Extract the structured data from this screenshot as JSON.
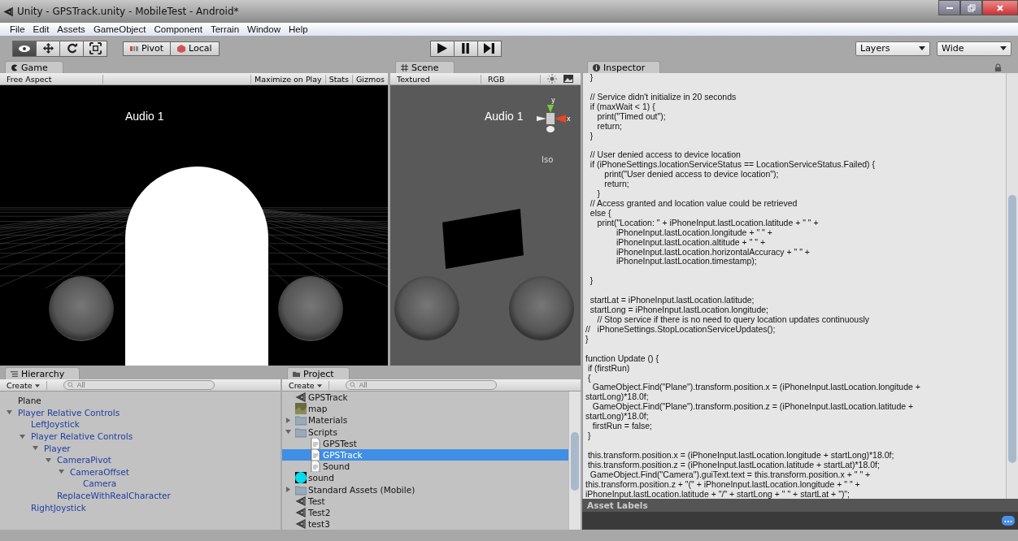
{
  "window": {
    "title": "Unity - GPSTrack.unity - MobileTest - Android*"
  },
  "menu": [
    "File",
    "Edit",
    "Assets",
    "GameObject",
    "Component",
    "Terrain",
    "Window",
    "Help"
  ],
  "toolbar": {
    "tools": [
      {
        "kind": "view",
        "selected": true
      },
      {
        "kind": "move",
        "selected": false
      },
      {
        "kind": "rotate",
        "selected": false
      },
      {
        "kind": "scale",
        "selected": false
      }
    ],
    "pivot": "Pivot",
    "local": "Local",
    "playback": [
      {
        "kind": "play"
      },
      {
        "kind": "pause"
      },
      {
        "kind": "step"
      }
    ],
    "layers": "Layers",
    "layout": "Wide"
  },
  "game": {
    "tab": "Game",
    "aspect": "Free Aspect",
    "buttons": [
      "Maximize on Play",
      "Stats",
      "Gizmos"
    ],
    "overlay_text": "Audio 1"
  },
  "scene": {
    "tab": "Scene",
    "render_mode": "Textured",
    "channel": "RGB",
    "overlay_text": "Audio 1",
    "gizmo_axes": [
      "y",
      "x"
    ],
    "projection": "Iso"
  },
  "inspector": {
    "tab": "Inspector",
    "code_blocks": [
      [
        "  }"
      ],
      [
        "  // Service didn't initialize in 20 seconds",
        "  if (maxWait < 1) {",
        "     print(\"Timed out\");",
        "     return;",
        "  }"
      ],
      [
        "  // User denied access to device location",
        "  if (iPhoneSettings.locationServiceStatus == LocationServiceStatus.Failed) {",
        "        print(\"User denied access to device location\");",
        "        return;",
        "     }",
        "  // Access granted and location value could be retrieved",
        "  else {",
        "     print(\"Location: \" + iPhoneInput.lastLocation.latitude + \" \" +",
        "             iPhoneInput.lastLocation.longitude + \" \" +",
        "             iPhoneInput.lastLocation.altitude + \" \" +",
        "             iPhoneInput.lastLocation.horizontalAccuracy + \" \" +",
        "             iPhoneInput.lastLocation.timestamp);"
      ],
      [
        "  }"
      ],
      [
        "  startLat = iPhoneInput.lastLocation.latitude;",
        "  startLong = iPhoneInput.lastLocation.longitude;",
        "     // Stop service if there is no need to query location updates continuously",
        "//   iPhoneSettings.StopLocationServiceUpdates();",
        "}"
      ],
      [
        "function Update () {",
        " if (firstRun)",
        " {",
        "   GameObject.Find(\"Plane\").transform.position.x = (iPhoneInput.lastLocation.longitude +",
        "startLong)*18.0f;",
        "   GameObject.Find(\"Plane\").transform.position.z = (iPhoneInput.lastLocation.latitude +",
        "startLong)*18.0f;",
        "   firstRun = false;",
        " }"
      ],
      [
        " this.transform.position.x = (iPhoneInput.lastLocation.longitude + startLong)*18.0f;",
        " this.transform.position.z = (iPhoneInput.lastLocation.latitude + startLat)*18.0f;",
        "  GameObject.Find(\"Camera\").guiText.text = this.transform.position.x + \" \" +",
        "this.transform.position.z + \"(\" + iPhoneInput.lastLocation.longitude + \" \" +",
        "iPhoneInput.lastLocation.latitude + \"/\" + startLong + \" \" + startLat + \")\";"
      ]
    ],
    "asset_labels": "Asset Labels"
  },
  "hierarchy": {
    "tab": "Hierarchy",
    "create": "Create",
    "search_placeholder": "All",
    "items": [
      {
        "label": "Plane",
        "kind": "object"
      },
      {
        "label": "Player Relative Controls",
        "kind": "prefab",
        "expanded": true,
        "children": [
          {
            "label": "LeftJoystick",
            "kind": "prefab"
          },
          {
            "label": "Player Relative Controls",
            "kind": "prefab",
            "expanded": true,
            "children": [
              {
                "label": "Player",
                "kind": "prefab",
                "expanded": true,
                "children": [
                  {
                    "label": "CameraPivot",
                    "kind": "prefab",
                    "expanded": true,
                    "children": [
                      {
                        "label": "CameraOffset",
                        "kind": "prefab",
                        "expanded": true,
                        "children": [
                          {
                            "label": "Camera",
                            "kind": "prefab"
                          }
                        ]
                      }
                    ]
                  },
                  {
                    "label": "ReplaceWithRealCharacter",
                    "kind": "prefab"
                  }
                ]
              }
            ]
          },
          {
            "label": "RightJoystick",
            "kind": "prefab"
          }
        ]
      }
    ]
  },
  "project": {
    "tab": "Project",
    "create": "Create",
    "search_placeholder": "All",
    "items": [
      {
        "label": "GPSTrack",
        "kind": "scene",
        "selected": false
      },
      {
        "label": "map",
        "kind": "texture",
        "selected": false
      },
      {
        "label": "Materials",
        "kind": "folder",
        "expanded": false,
        "selected": false
      },
      {
        "label": "Scripts",
        "kind": "folder",
        "expanded": true,
        "selected": false,
        "children": [
          {
            "label": "GPSTest",
            "kind": "script",
            "selected": false
          },
          {
            "label": "GPSTrack",
            "kind": "script",
            "selected": true
          },
          {
            "label": "Sound",
            "kind": "script",
            "selected": false
          }
        ]
      },
      {
        "label": "sound",
        "kind": "audio",
        "selected": false
      },
      {
        "label": "Standard Assets (Mobile)",
        "kind": "folder",
        "expanded": false,
        "selected": false
      },
      {
        "label": "Test",
        "kind": "scene",
        "selected": false
      },
      {
        "label": "Test2",
        "kind": "scene",
        "selected": false
      },
      {
        "label": "test3",
        "kind": "scene",
        "selected": false
      }
    ]
  }
}
